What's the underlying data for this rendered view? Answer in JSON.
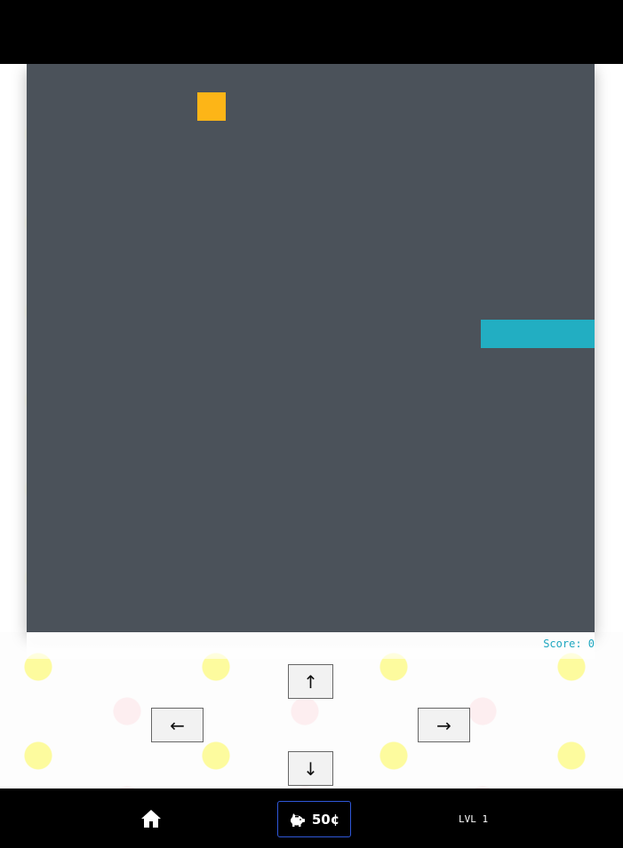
{
  "colors": {
    "top_bar": "#000000",
    "board": "#4b525a",
    "food": "#fdb517",
    "snake": "#22aec2",
    "score": "#1ea7c0",
    "coins_border": "#2f57d9"
  },
  "game": {
    "grid_columns": 20,
    "grid_rows": 20,
    "food": {
      "col": 6,
      "row": 1
    },
    "snake": [
      {
        "col": 16,
        "row": 9
      },
      {
        "col": 17,
        "row": 9
      },
      {
        "col": 18,
        "row": 9
      },
      {
        "col": 19,
        "row": 9
      }
    ],
    "score_label": "Score: 0"
  },
  "controls": {
    "up": "↑",
    "left": "←",
    "right": "→",
    "down": "↓"
  },
  "bottom_bar": {
    "home_icon": "home-icon",
    "coins_icon": "piggy-bank-icon",
    "coins": "50¢",
    "level": "LVL 1"
  }
}
